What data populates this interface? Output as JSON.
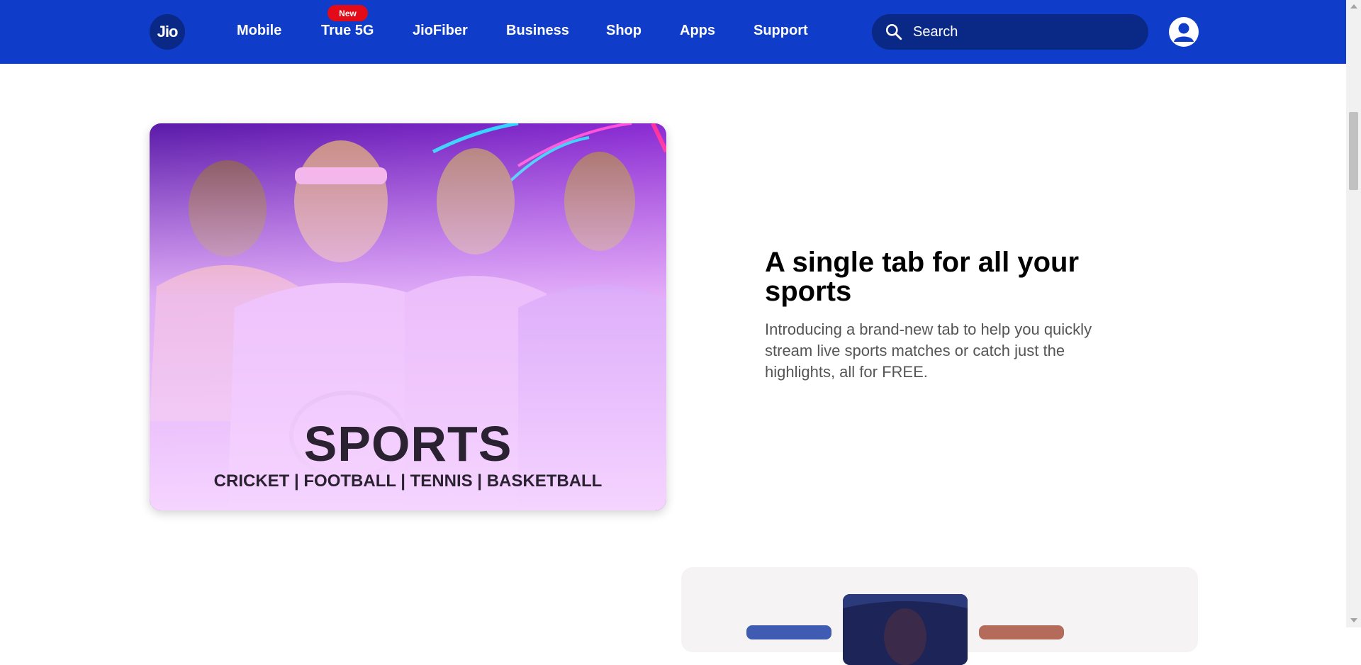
{
  "header": {
    "logo_text": "Jio",
    "nav": [
      "Mobile",
      "True 5G",
      "JioFiber",
      "Business",
      "Shop",
      "Apps",
      "Support"
    ],
    "new_badge": "New",
    "search": {
      "placeholder": "Search",
      "value": ""
    }
  },
  "hero": {
    "title": "SPORTS",
    "subtitle": "CRICKET | FOOTBALL | TENNIS | BASKETBALL"
  },
  "feature": {
    "heading": "A single tab for all your sports",
    "description": "Introducing a brand-new tab to help you quickly stream live sports matches or catch just the highlights, all for FREE."
  },
  "colors": {
    "header_bg": "#0f3cc9",
    "search_bg": "#0a2885",
    "badge_red": "#e30b17"
  }
}
